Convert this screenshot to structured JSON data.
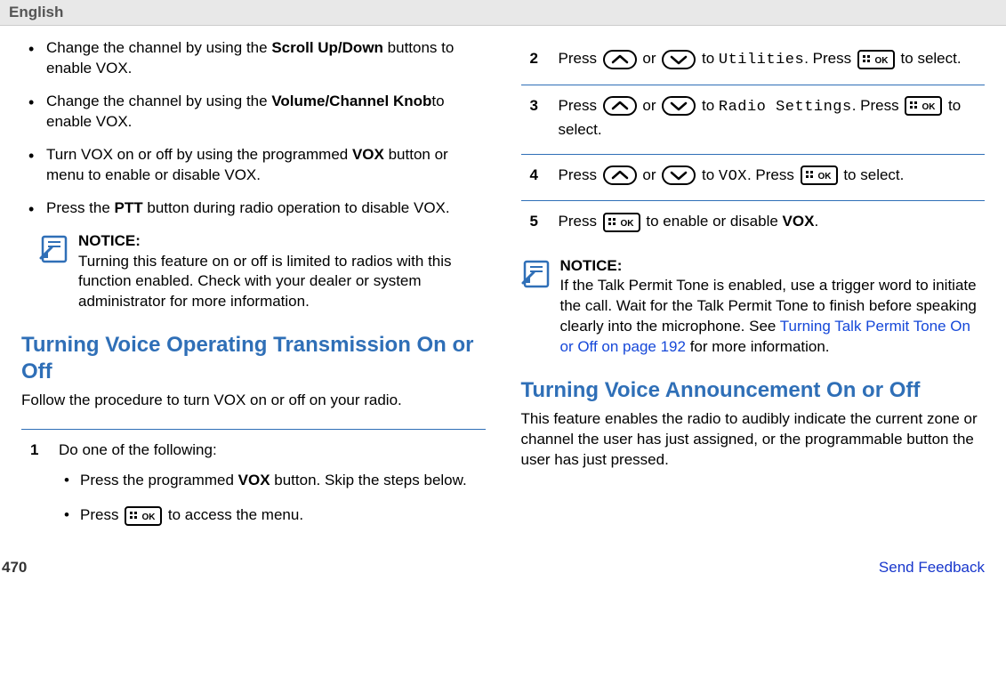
{
  "header": {
    "language": "English"
  },
  "left": {
    "bullets": [
      {
        "pre": "Change the channel by using the ",
        "bold": "Scroll Up/Down",
        "post": " buttons to enable VOX."
      },
      {
        "pre": "Change the channel by using the ",
        "bold": "Volume/Channel Knob",
        "post": "to enable VOX."
      },
      {
        "pre": "Turn VOX on or off by using the programmed ",
        "bold": "VOX",
        "post": " button or menu to enable or disable VOX."
      },
      {
        "pre": "Press the ",
        "bold": "PTT",
        "post": " button during radio operation to disable VOX."
      }
    ],
    "notice": {
      "title": "NOTICE:",
      "body": "Turning this feature on or off is limited to radios with this function enabled. Check with your dealer or system administrator for more information."
    },
    "section_title": "Turning Voice Operating Transmission On or Off",
    "intro": "Follow the procedure to turn VOX on or off on your radio.",
    "step1": {
      "num": "1",
      "text": "Do one of the following:",
      "sub": [
        {
          "pre": "Press the programmed ",
          "bold": "VOX",
          "post": " button. Skip the steps below."
        },
        {
          "pre": "Press ",
          "post": " to access the menu."
        }
      ]
    }
  },
  "right": {
    "steps": [
      {
        "num": "2",
        "parts": {
          "a": "Press ",
          "b": " or ",
          "c": " to ",
          "mono": "Utilities",
          "d": ". Press ",
          "e": " to select."
        }
      },
      {
        "num": "3",
        "parts": {
          "a": "Press ",
          "b": " or ",
          "c": " to ",
          "mono": "Radio Settings",
          "d": ". Press ",
          "e": " to select."
        }
      },
      {
        "num": "4",
        "parts": {
          "a": "Press ",
          "b": " or ",
          "c": " to ",
          "mono": "VOX",
          "d": ". Press ",
          "e": " to select."
        }
      },
      {
        "num": "5",
        "parts": {
          "a": "Press ",
          "b": " to enable or disable ",
          "bold": "VOX",
          "c": "."
        }
      }
    ],
    "notice": {
      "title": "NOTICE:",
      "body_pre": "If the Talk Permit Tone is enabled, use a trigger word to initiate the call. Wait for the Talk Permit Tone to finish before speaking clearly into the microphone. See ",
      "link": "Turning Talk Permit Tone On or Off on page 192",
      "body_post": " for more information."
    },
    "section_title": "Turning Voice Announcement On or Off",
    "intro": "This feature enables the radio to audibly indicate the current zone or channel the user has just assigned, or the programmable button the user has just pressed."
  },
  "footer": {
    "page": "470",
    "feedback": "Send Feedback"
  }
}
